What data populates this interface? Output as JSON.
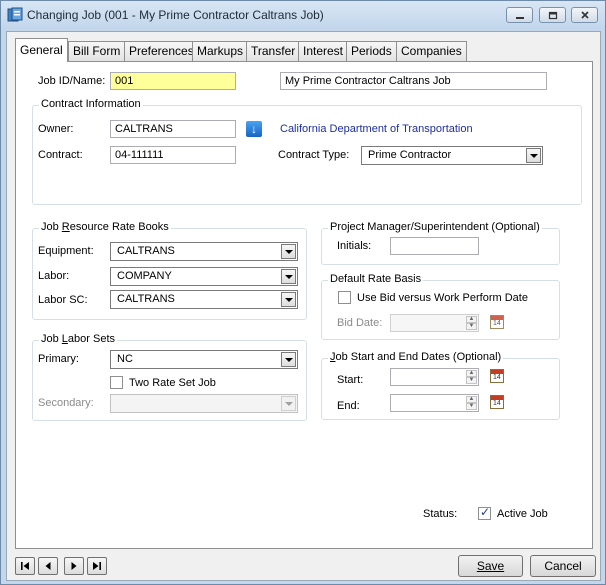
{
  "window": {
    "title": "Changing Job  (001 - My Prime Contractor Caltrans Job)"
  },
  "tabs": [
    "General",
    "Bill Form",
    "Preferences",
    "Markups",
    "Transfer",
    "Interest",
    "Periods",
    "Companies"
  ],
  "job": {
    "id_label": "Job ID/Name:",
    "id_value": "001",
    "name_value": "My Prime Contractor Caltrans Job"
  },
  "contract_info": {
    "legend": "Contract Information",
    "owner_label": "Owner:",
    "owner_value": "CALTRANS",
    "owner_description": "California Department of Transportation",
    "contract_label": "Contract:",
    "contract_value": "04-111111",
    "contract_type_label": "Contract Type:",
    "contract_type_value": "Prime Contractor"
  },
  "rate_books": {
    "legend": "Job Resource Rate Books",
    "equipment_label": "Equipment:",
    "equipment_value": "CALTRANS",
    "labor_label": "Labor:",
    "labor_value": "COMPANY",
    "labor_sc_label": "Labor SC:",
    "labor_sc_value": "CALTRANS"
  },
  "labor_sets": {
    "legend": "Job Labor Sets",
    "primary_label": "Primary:",
    "primary_value": "NC",
    "two_rate_label": "Two Rate Set Job",
    "two_rate_checked": false,
    "secondary_label": "Secondary:",
    "secondary_value": ""
  },
  "project_manager": {
    "legend": "Project Manager/Superintendent (Optional)",
    "initials_label": "Initials:",
    "initials_value": ""
  },
  "default_rate_basis": {
    "legend": "Default Rate Basis",
    "use_bid_label": "Use Bid versus Work Perform Date",
    "use_bid_checked": false,
    "bid_date_label": "Bid Date:",
    "bid_date_value": ""
  },
  "dates": {
    "legend": "Job Start and End Dates (Optional)",
    "start_label": "Start:",
    "start_value": "",
    "end_label": "End:",
    "end_value": ""
  },
  "status": {
    "label": "Status:",
    "active_label": "Active Job",
    "active_checked": true
  },
  "nav": {
    "first": "|◀",
    "prev": "◀",
    "next": "▶",
    "last": "▶|"
  },
  "buttons": {
    "save": "Save",
    "cancel": "Cancel"
  },
  "colors": {
    "accent_link": "#1f2f9a",
    "required_field": "#ffff99",
    "titlebar": "#c4d7ea"
  }
}
